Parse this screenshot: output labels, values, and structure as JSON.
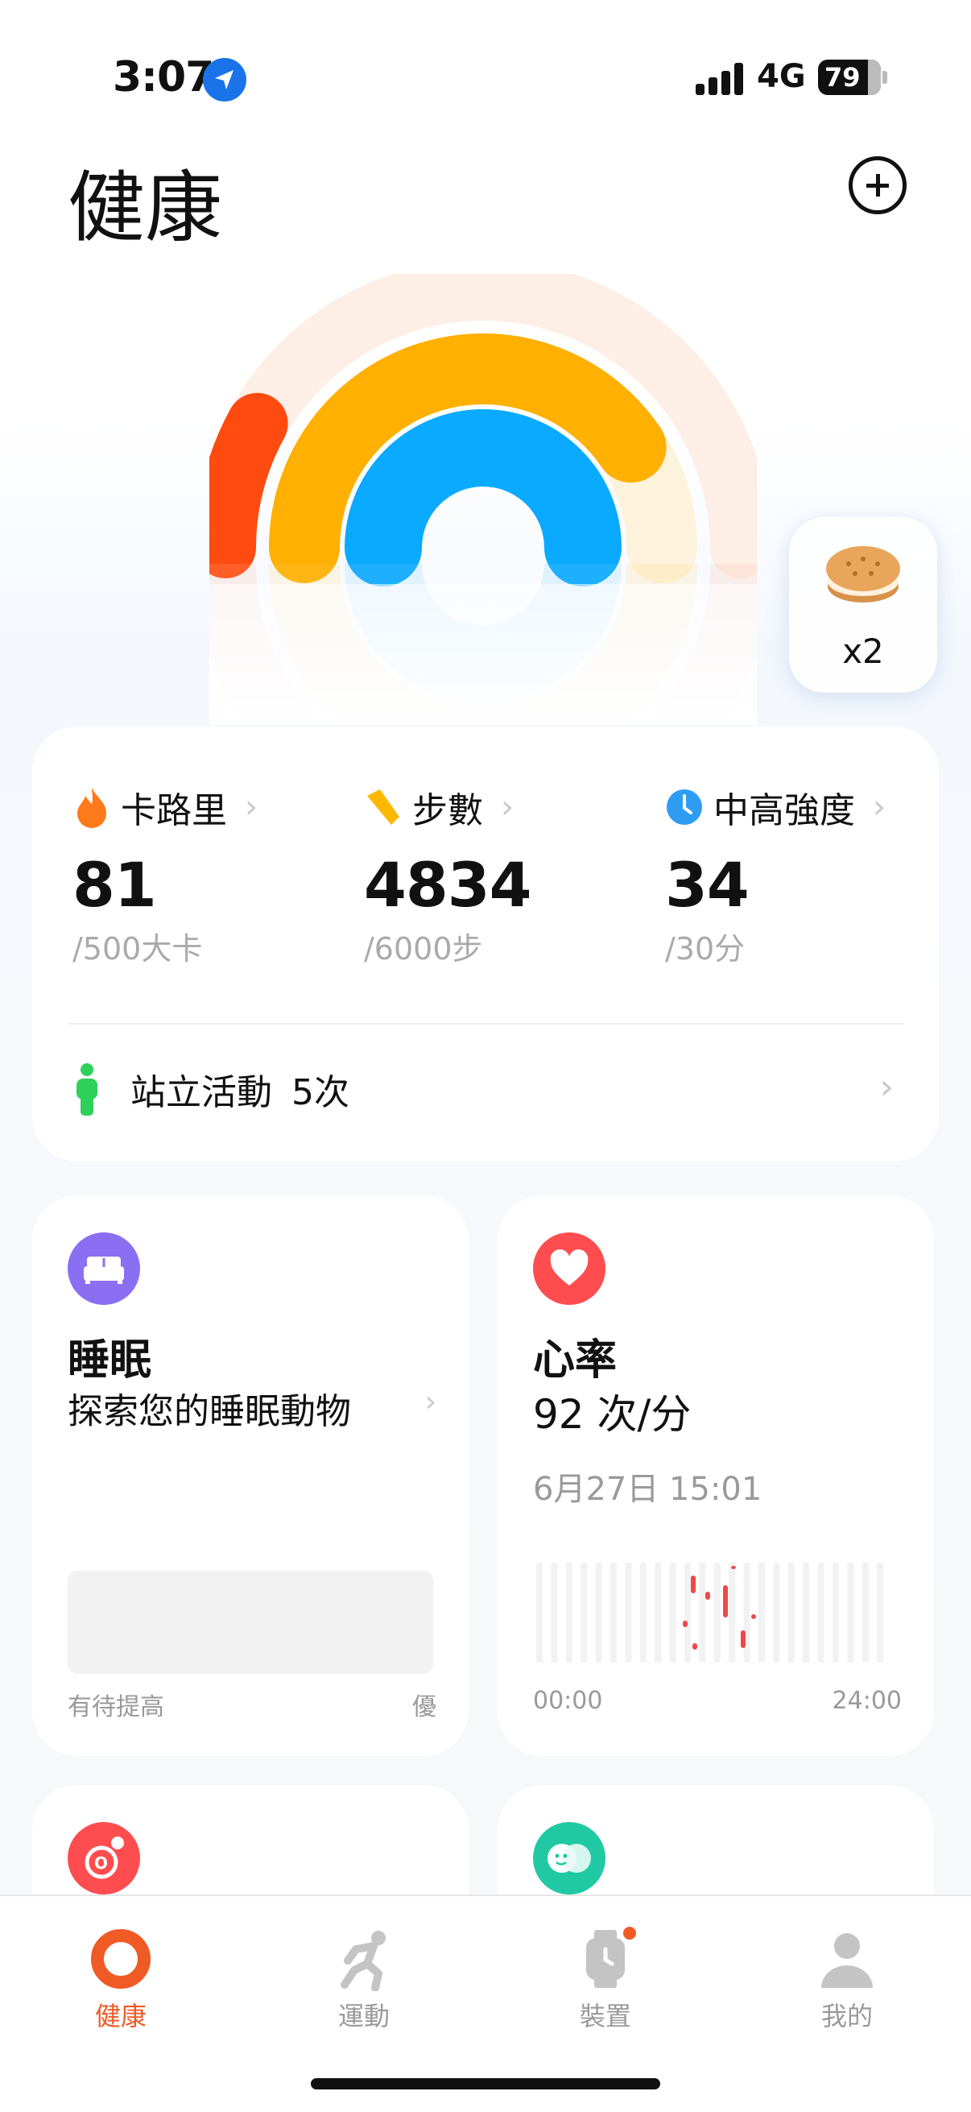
{
  "status_bar": {
    "time": "3:07",
    "network": "4G",
    "battery": "79"
  },
  "header": {
    "title": "健康"
  },
  "rings": {
    "calories_progress": 0.16,
    "steps_progress": 0.81,
    "intensity_progress": 1.0,
    "colors": {
      "calories": "#ff4b10",
      "steps": "#ffb000",
      "intensity": "#09aaff"
    }
  },
  "rewards": {
    "count": "x2"
  },
  "activity": {
    "calories": {
      "label": "卡路里",
      "value": "81",
      "goal": "/500大卡"
    },
    "steps": {
      "label": "步數",
      "value": "4834",
      "goal": "/6000步"
    },
    "intensity": {
      "label": "中高強度",
      "value": "34",
      "goal": "/30分"
    },
    "stand": {
      "label": "站立活動",
      "count": "5次"
    }
  },
  "sleep": {
    "title": "睡眠",
    "subtitle": "探索您的睡眠動物",
    "scale_low": "有待提高",
    "scale_high": "優"
  },
  "heart_rate": {
    "title": "心率",
    "value": "92 次/分",
    "date": "6月27日 15:01",
    "x_start": "00:00",
    "x_end": "24:00"
  },
  "tabs": [
    {
      "label": "健康",
      "active": true
    },
    {
      "label": "運動",
      "active": false
    },
    {
      "label": "裝置",
      "active": false
    },
    {
      "label": "我的",
      "active": false
    }
  ],
  "chevron": "›"
}
